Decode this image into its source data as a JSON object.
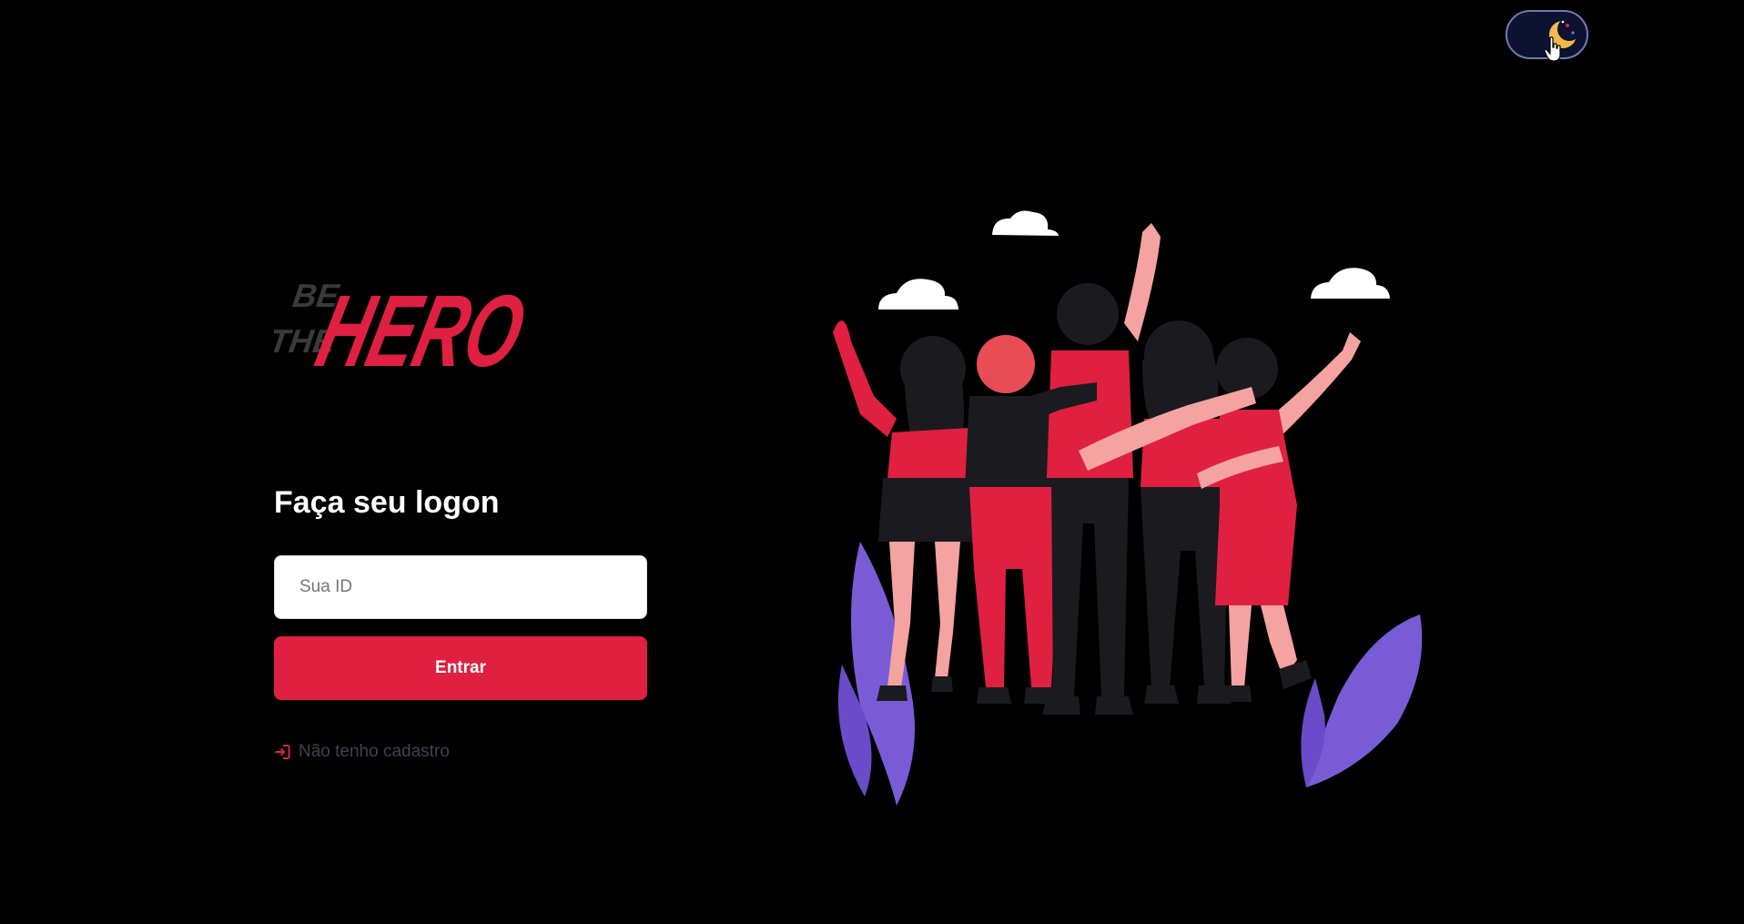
{
  "logo": {
    "be": "BE",
    "the": "THE",
    "hero": "HERO"
  },
  "logon": {
    "title": "Faça seu logon",
    "id_placeholder": "Sua ID",
    "enter_label": "Entrar",
    "register_label": "Não tenho cadastro"
  },
  "theme_toggle": {
    "mode": "dark",
    "icon": "moon-icon"
  },
  "colors": {
    "background": "#000000",
    "brand": "#e02041",
    "link": "#41414d",
    "toggle": "#0c1230"
  }
}
